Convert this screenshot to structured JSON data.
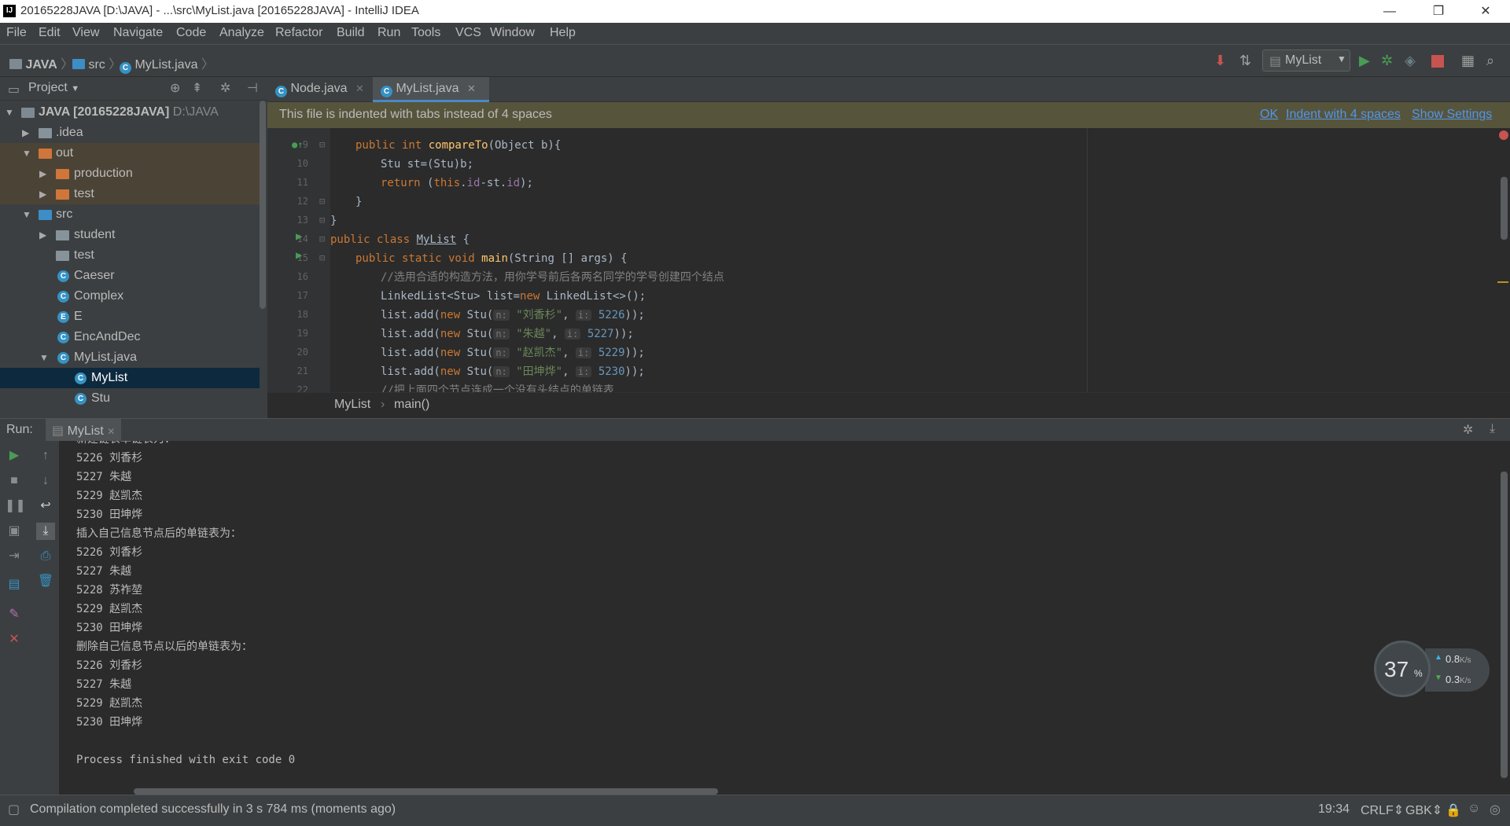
{
  "window": {
    "title": "20165228JAVA [D:\\JAVA] - ...\\src\\MyList.java [20165228JAVA] - IntelliJ IDEA",
    "app_icon": "IJ",
    "minimize": "—",
    "restore": "❐",
    "close": "✕"
  },
  "menu": [
    "File",
    "Edit",
    "View",
    "Navigate",
    "Code",
    "Analyze",
    "Refactor",
    "Build",
    "Run",
    "Tools",
    "VCS",
    "Window",
    "Help"
  ],
  "navbar": {
    "crumbs": [
      "JAVA",
      "src",
      "MyList.java"
    ],
    "run_config": "MyList"
  },
  "project_panel": {
    "title": "Project",
    "tree": [
      {
        "label": "JAVA [20165228JAVA]",
        "suffix": "D:\\JAVA",
        "icon": "module-icon"
      },
      {
        "label": ".idea",
        "icon": "folder-icon"
      },
      {
        "label": "out",
        "icon": "folder-orange-icon"
      },
      {
        "label": "production",
        "icon": "folder-orange-icon"
      },
      {
        "label": "test",
        "icon": "folder-orange-icon"
      },
      {
        "label": "src",
        "icon": "folder-blue-icon"
      },
      {
        "label": "student",
        "icon": "package-icon"
      },
      {
        "label": "test",
        "icon": "package-icon"
      },
      {
        "label": "Caeser",
        "icon": "class-icon"
      },
      {
        "label": "Complex",
        "icon": "class-icon"
      },
      {
        "label": "E",
        "icon": "enum-icon"
      },
      {
        "label": "EncAndDec",
        "icon": "class-icon"
      },
      {
        "label": "MyList.java",
        "icon": "class-file-icon"
      },
      {
        "label": "MyList",
        "icon": "class-icon"
      },
      {
        "label": "Stu",
        "icon": "class-icon"
      }
    ]
  },
  "tabs": [
    {
      "label": "Node.java",
      "active": false
    },
    {
      "label": "MyList.java",
      "active": true
    }
  ],
  "banner": {
    "message": "This file is indented with tabs instead of 4 spaces",
    "ok": "OK",
    "indent": "Indent with 4 spaces",
    "settings": "Show Settings"
  },
  "code": {
    "line_numbers": [
      "9",
      "10",
      "11",
      "12",
      "13",
      "14",
      "15",
      "16",
      "17",
      "18",
      "19",
      "20",
      "21",
      "22"
    ],
    "l9": {
      "kw1": "public int ",
      "fn": "compareTo",
      "rest": "(Object b){"
    },
    "l10": "Stu st=(Stu)b;",
    "l11": {
      "kw1": "return ",
      "p1": "(",
      "kw2": "this",
      "p2": ".",
      "f1": "id",
      "p3": "-st.",
      "f2": "id",
      "p4": ");"
    },
    "l12": "}",
    "l13": "}",
    "l14": {
      "kw": "public class ",
      "name": "MyList",
      "rest": " {"
    },
    "l15": {
      "kw": "public static void ",
      "fn": "main",
      "rest": "(String [] args) {"
    },
    "l16": "//选用合适的构造方法，用你学号前后各两名同学的学号创建四个结点",
    "l17": {
      "a": "LinkedList<Stu> list=",
      "kw": "new",
      "b": " LinkedList<>();"
    },
    "adds": [
      {
        "name": "\"刘香杉\"",
        "id": "5226"
      },
      {
        "name": "\"朱越\"",
        "id": "5227"
      },
      {
        "name": "\"赵凯杰\"",
        "id": "5229"
      },
      {
        "name": "\"田坤烨\"",
        "id": "5230"
      }
    ],
    "add_prefix": "list.add(",
    "add_new": "new",
    "add_ctor": " Stu(",
    "hint_n": "n:",
    "hint_i": "i:",
    "comma": ", ",
    "add_close": "));",
    "l22": "//把上面四个节点连成一个没有头结点的单链表"
  },
  "editor_breadcrumb": [
    "MyList",
    "main()"
  ],
  "run": {
    "label": "Run:",
    "tab": "MyList",
    "output": [
      "新建链表单链表为：",
      "5226 刘香杉",
      "5227 朱越",
      "5229 赵凯杰",
      "5230 田坤烨",
      "插入自己信息节点后的单链表为：",
      "5226 刘香杉",
      "5227 朱越",
      "5228 苏祚堃",
      "5229 赵凯杰",
      "5230 田坤烨",
      "删除自己信息节点以后的单链表为：",
      "5226 刘香杉",
      "5227 朱越",
      "5229 赵凯杰",
      "5230 田坤烨",
      "",
      "Process finished with exit code 0"
    ]
  },
  "status": {
    "message": "Compilation completed successfully in 3 s 784 ms (moments ago)",
    "position": "19:34",
    "line_sep": "CRLF",
    "encoding": "GBK"
  },
  "widget": {
    "percent": "37",
    "percent_unit": "%",
    "up": "0.8",
    "down": "0.3",
    "unit": "K/s"
  },
  "colors": {
    "accent": "#4a88c7",
    "run_green": "#499c54",
    "stop_red": "#c75450",
    "selection": "#0d293e"
  }
}
